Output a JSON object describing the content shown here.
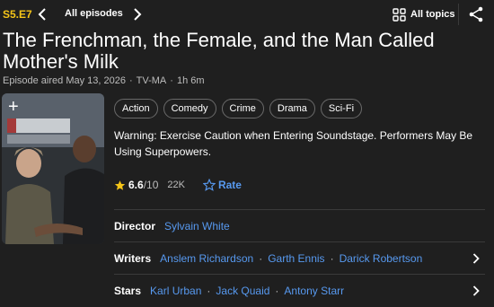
{
  "topbar": {
    "episode_code": "S5.E7",
    "all_episodes_label": "All episodes",
    "all_topics_label": "All topics"
  },
  "episode": {
    "title": "The Frenchman, the Female, and the Man Called Mother's Milk",
    "aired": "Episode aired May 13, 2026",
    "rating_cert": "TV-MA",
    "runtime": "1h 6m",
    "separator": "·"
  },
  "poster": {
    "add_symbol": "+"
  },
  "genres": [
    "Action",
    "Comedy",
    "Crime",
    "Drama",
    "Sci-Fi"
  ],
  "plot": "Warning: Exercise Caution when Entering Soundstage. Performers May Be Using Superpowers.",
  "rating": {
    "value": "6.6",
    "max": "/10",
    "votes": "22K",
    "rate_label": "Rate"
  },
  "credits": {
    "director": {
      "role": "Director",
      "names": [
        "Sylvain White"
      ]
    },
    "writers": {
      "role": "Writers",
      "names": [
        "Anslem Richardson",
        "Garth Ennis",
        "Darick Robertson"
      ]
    },
    "stars": {
      "role": "Stars",
      "names": [
        "Karl Urban",
        "Jack Quaid",
        "Antony Starr"
      ]
    }
  },
  "colors": {
    "background": "#1f1f1f",
    "accent_yellow": "#f5c518",
    "link_blue": "#5799ef",
    "muted_text": "#bdbdbd"
  },
  "icons": [
    "chevron-left-icon",
    "chevron-right-icon",
    "topics-grid-icon",
    "share-icon",
    "star-icon",
    "star-outline-icon"
  ]
}
